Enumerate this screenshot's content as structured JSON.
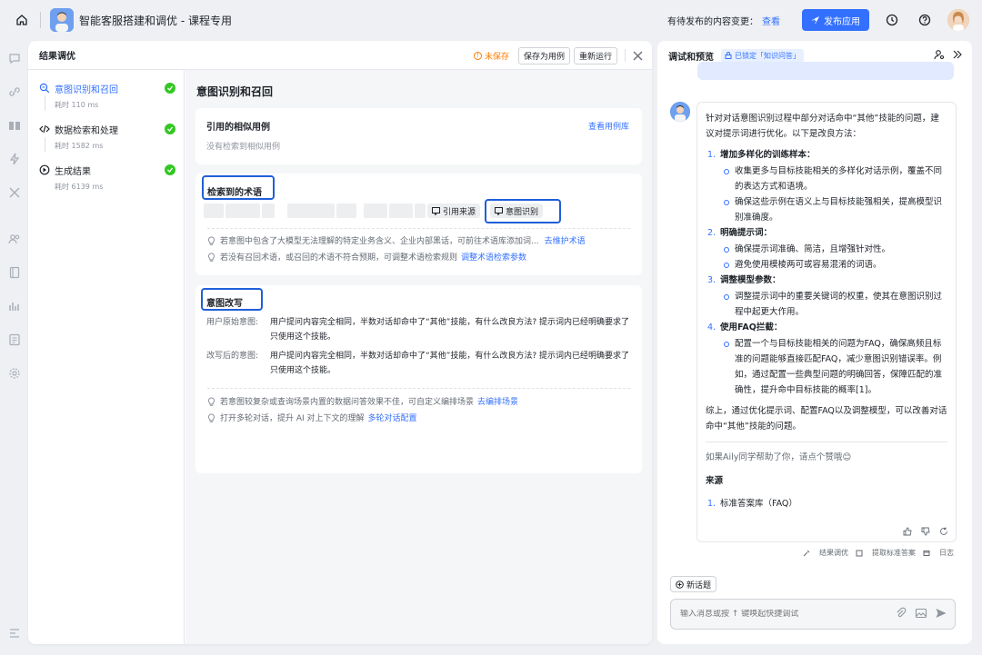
{
  "app": {
    "title": "智能客服搭建和调优 - 课程专用"
  },
  "topbar": {
    "pending_text": "有待发布的内容变更：",
    "pending_link": "查看",
    "publish_label": "发布应用"
  },
  "panel": {
    "title": "结果调优",
    "unsaved": "未保存",
    "save_case": "保存为用例",
    "rerun": "重新运行"
  },
  "steps": [
    {
      "label": "意图识别和召回",
      "time": "耗时 110 ms"
    },
    {
      "label": "数据检索和处理",
      "time": "耗时 1582 ms"
    },
    {
      "label": "生成结果",
      "time": "耗时 6139 ms"
    }
  ],
  "content": {
    "title": "意图识别和召回",
    "similar": {
      "title": "引用的相似用例",
      "link": "查看用例库",
      "empty": "没有检索到相似用例"
    },
    "terms": {
      "title": "检索到的术语",
      "chip_source": "引用来源",
      "chip_intent": "意图识别",
      "tip1": "若意图中包含了大模型无法理解的特定业务含义、企业内部黑话，可前往术语库添加词...",
      "tip1_link": "去维护术语",
      "tip2": "若没有召回术语，或召回的术语不符合预期，可调整术语检索规则",
      "tip2_link": "调整术语检索参数"
    },
    "rewrite": {
      "title": "意图改写",
      "orig_label": "用户原始意图:",
      "orig_text": "用户提问内容完全相同，半数对话却命中了“其他”技能，有什么改良方法? 提示词内已经明确要求了只使用这个技能。",
      "new_label": "改写后的意图:",
      "new_text": "用户提问内容完全相同，半数对话却命中了“其他”技能，有什么改良方法? 提示词内已经明确要求了只使用这个技能。",
      "tip1": "若意图较复杂或查询场景内置的数据问答效果不佳，可自定义编排场景",
      "tip1_link": "去编排场景",
      "tip2": "打开多轮对话，提升 AI 对上下文的理解",
      "tip2_link": "多轮对话配置"
    }
  },
  "right": {
    "title": "调试和预览",
    "locked": "已锁定「知识问答」",
    "answer": {
      "intro": "针对对话意图识别过程中部分对话命中“其他”技能的问题，建议对提示词进行优化。以下是改良方法：",
      "items": [
        {
          "n": "1.",
          "head": "增加多样化的训练样本：",
          "subs": [
            "收集更多与目标技能相关的多样化对话示例，覆盖不同的表达方式和语境。",
            "确保这些示例在语义上与目标技能强相关，提高模型识别准确度。"
          ]
        },
        {
          "n": "2.",
          "head": "明确提示词：",
          "subs": [
            "确保提示词准确、简洁，且增强针对性。",
            "避免使用模棱两可或容易混淆的词语。"
          ]
        },
        {
          "n": "3.",
          "head": "调整模型参数：",
          "subs": [
            "调整提示词中的重要关键词的权重，使其在意图识别过程中起更大作用。"
          ]
        },
        {
          "n": "4.",
          "head": "使用FAQ拦截：",
          "subs": [
            "配置一个与目标技能相关的问题为FAQ，确保高频且标准的问题能够直接匹配FAQ，减少意图识别错误率。例如，通过配置一些典型问题的明确回答，保障匹配的准确性，提升命中目标技能的概率[1]。"
          ]
        }
      ],
      "summary": "综上，通过优化提示词、配置FAQ以及调整模型，可以改善对话命中“其他”技能的问题。",
      "thanks": "如果Aily同学帮助了你，请点个赞哦😊",
      "source_title": "来源",
      "source_n": "1.",
      "source_item": "标准答案库（FAQ）"
    },
    "footer": {
      "tune": "结果调优",
      "extract": "提取标准答案",
      "log": "日志"
    },
    "new_topic": "新话题",
    "input_placeholder": "输入消息或按 ↑ 键唤起快捷调试"
  }
}
